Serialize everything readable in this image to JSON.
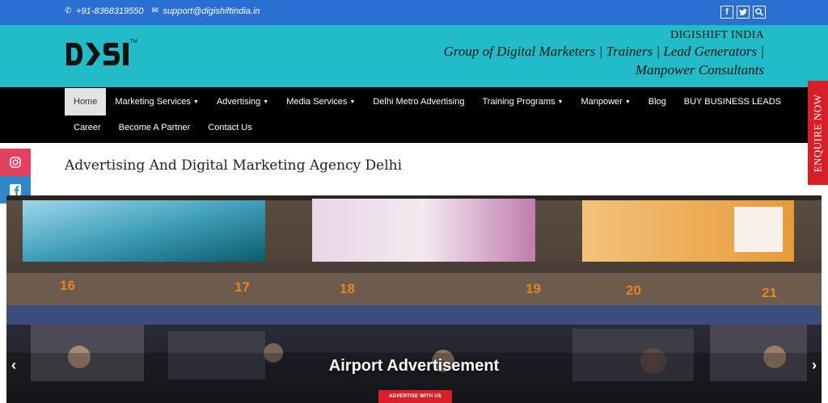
{
  "topbar": {
    "phone": "+91-8368319550",
    "email": "support@digishiftindia.in",
    "social_icons": [
      "facebook-icon",
      "twitter-icon",
      "search-icon"
    ]
  },
  "header": {
    "logo_text": "DSI",
    "logo_mark": "TM",
    "company_name": "DIGISHIFT INDIA",
    "tagline_line1": "Group of Digital Marketers | Trainers | Lead Generators |",
    "tagline_line2": "Manpower Consultants"
  },
  "nav": {
    "row1": [
      {
        "label": "Home",
        "active": true
      },
      {
        "label": "Marketing Services",
        "dropdown": true
      },
      {
        "label": "Advertising",
        "dropdown": true
      },
      {
        "label": "Media Services",
        "dropdown": true
      },
      {
        "label": "Delhi Metro Advertising"
      },
      {
        "label": "Training Programs",
        "dropdown": true
      },
      {
        "label": "Manpower",
        "dropdown": true
      },
      {
        "label": "Blog"
      },
      {
        "label": "BUY BUSINESS LEADS"
      }
    ],
    "row2": [
      {
        "label": "Career"
      },
      {
        "label": "Become A Partner"
      },
      {
        "label": "Contact Us"
      }
    ]
  },
  "page": {
    "title": "Advertising And Digital Marketing Agency Delhi"
  },
  "side_social": [
    "instagram-icon",
    "facebook-icon"
  ],
  "enquire_label": "ENQUIRE NOW",
  "hero": {
    "caption": "Airport Advertisement",
    "cta_label": "ADVERTISE WITH US",
    "counter_numbers": [
      "16",
      "17",
      "18",
      "19",
      "20",
      "21"
    ]
  },
  "colors": {
    "topbar": "#2a6fd1",
    "header": "#21bcc7",
    "nav": "#000000",
    "accent_red": "#d81f26"
  }
}
